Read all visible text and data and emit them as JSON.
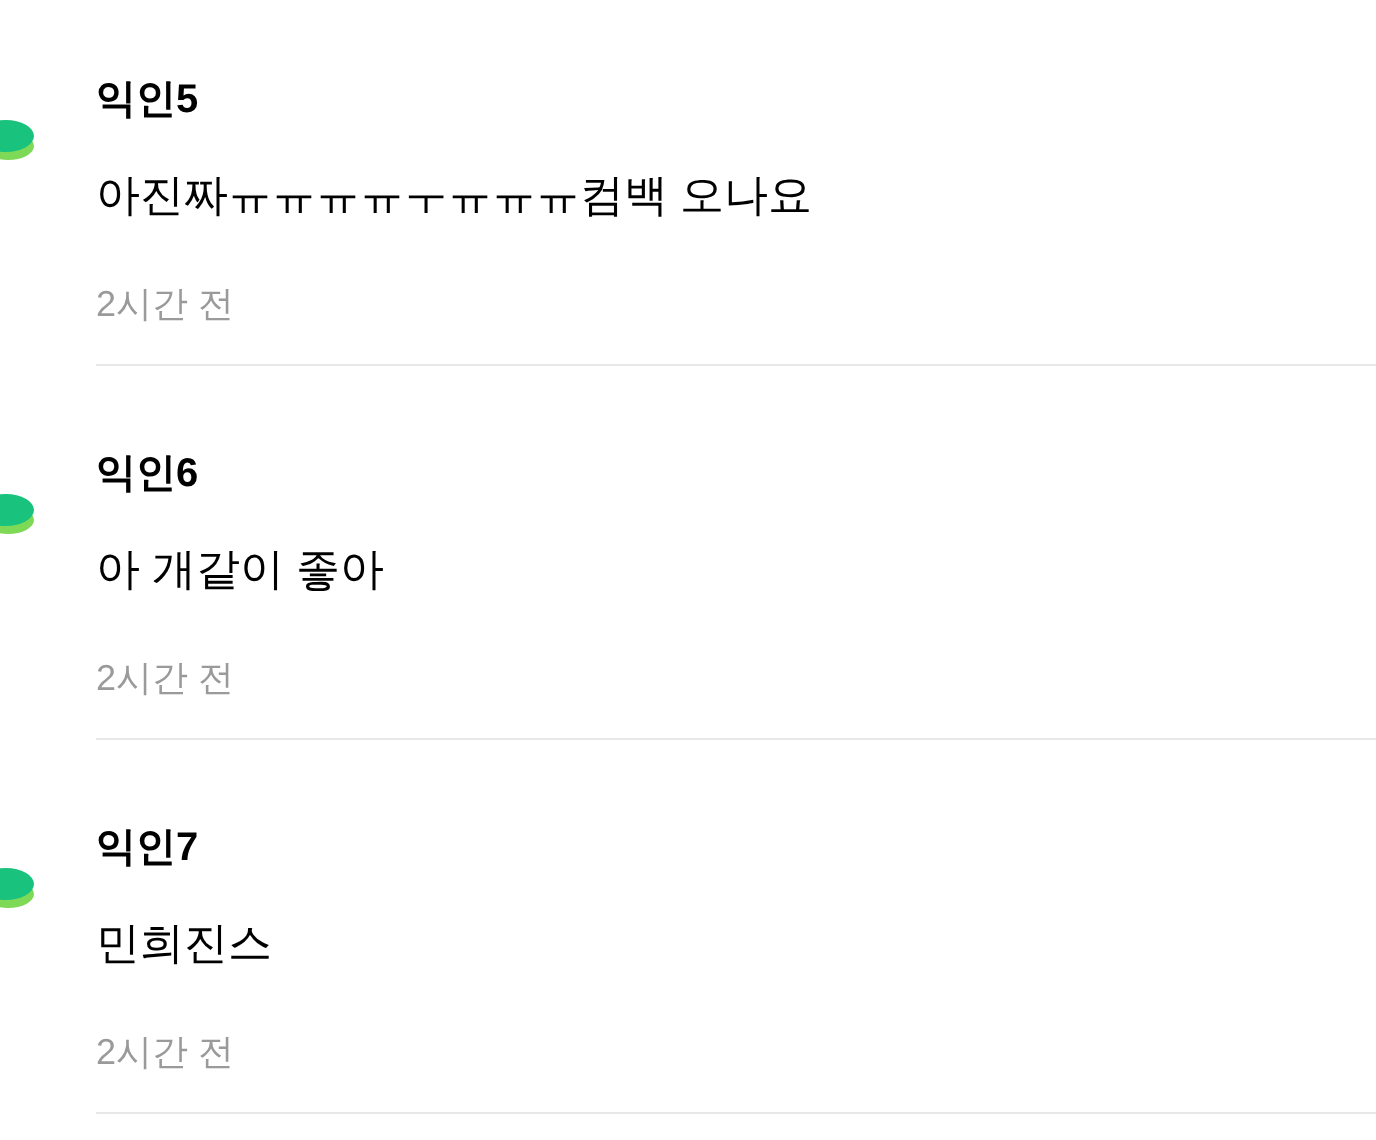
{
  "comments": [
    {
      "author": "익인5",
      "text": "아진짜ㅠㅠㅠㅠㅜㅠㅠㅠ컴백 오나요",
      "time": "2시간 전"
    },
    {
      "author": "익인6",
      "text": "아 개같이 좋아",
      "time": "2시간 전"
    },
    {
      "author": "익인7",
      "text": "민희진스",
      "time": "2시간 전"
    }
  ]
}
